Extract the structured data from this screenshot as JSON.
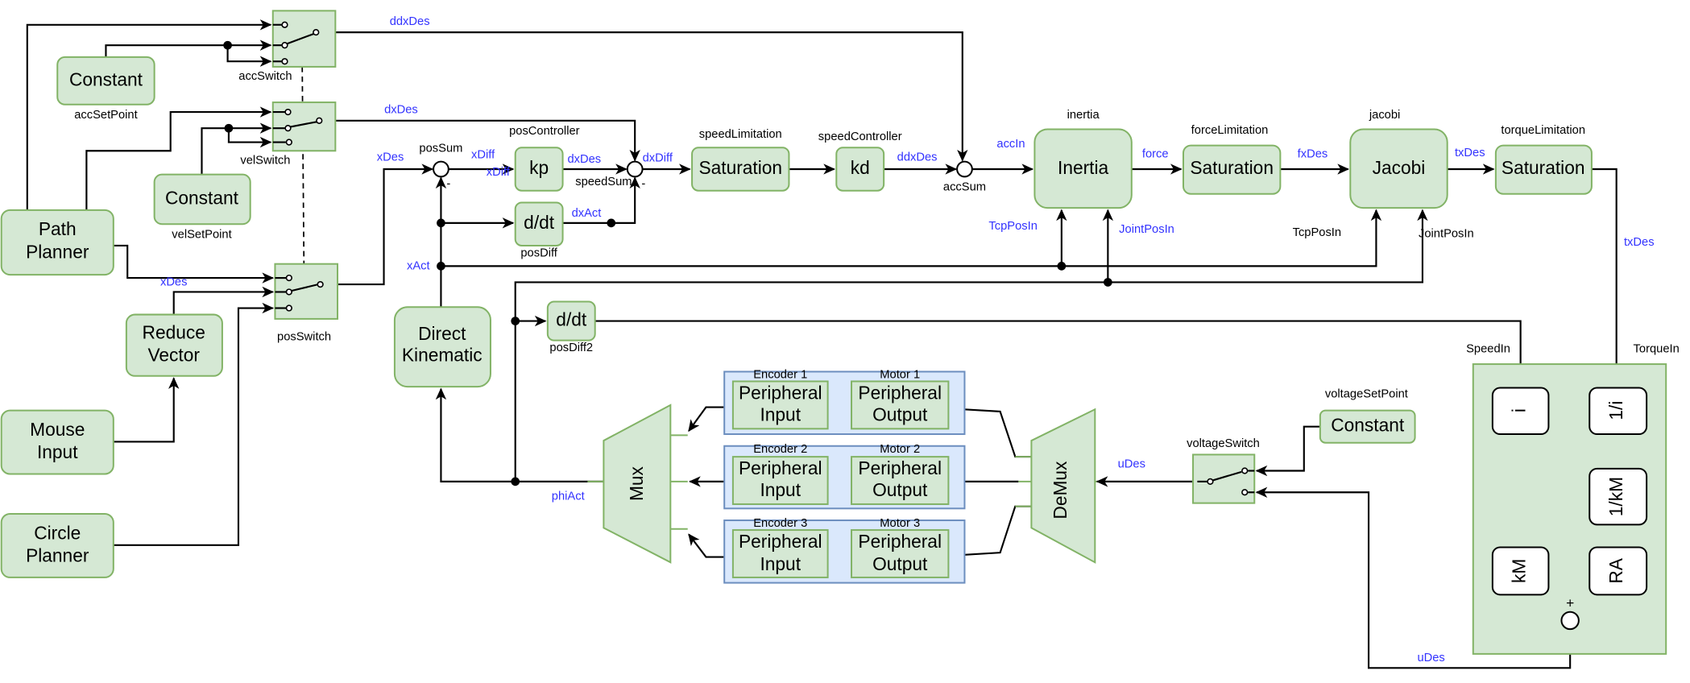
{
  "blocks": {
    "acc_constant": {
      "text": "Constant",
      "label": "accSetPoint"
    },
    "vel_constant": {
      "text": "Constant",
      "label": "velSetPoint"
    },
    "path_planner": {
      "line1": "Path",
      "line2": "Planner"
    },
    "reduce_vector": {
      "line1": "Reduce",
      "line2": "Vector"
    },
    "mouse_input": {
      "line1": "Mouse",
      "line2": "Input"
    },
    "circle_planner": {
      "line1": "Circle",
      "line2": "Planner"
    },
    "acc_switch": {
      "label": "accSwitch"
    },
    "vel_switch": {
      "label": "velSwitch"
    },
    "pos_switch": {
      "label": "posSwitch"
    },
    "pos_sum": {
      "label": "posSum",
      "sign": "-"
    },
    "kp": {
      "text": "kp",
      "label": "posController"
    },
    "pos_diff": {
      "text": "d/dt",
      "label": "posDiff"
    },
    "speed_sum": {
      "label": "speedSum",
      "sign": "-"
    },
    "speed_limitation": {
      "text": "Saturation",
      "label": "speedLimitation"
    },
    "kd": {
      "text": "kd",
      "label": "speedController"
    },
    "acc_sum": {
      "label": "accSum"
    },
    "inertia": {
      "text": "Inertia",
      "label": "inertia"
    },
    "force_limitation": {
      "text": "Saturation",
      "label": "forceLimitation"
    },
    "jacobi": {
      "text": "Jacobi",
      "label": "jacobi",
      "port1": "TcpPosIn",
      "port2": "JointPosIn"
    },
    "torque_limitation": {
      "text": "Saturation",
      "label": "torqueLimitation"
    },
    "direct_kinematic": {
      "line1": "Direct",
      "line2": "Kinematic"
    },
    "pos_diff2": {
      "text": "d/dt",
      "label": "posDiff2"
    },
    "mux": {
      "text": "Mux"
    },
    "demux": {
      "text": "DeMux"
    },
    "voltage_switch": {
      "label": "voltageSwitch"
    },
    "voltage_constant": {
      "text": "Constant",
      "label": "voltageSetPoint"
    },
    "motor": {
      "speed_in": "SpeedIn",
      "torque_in": "TorqueIn",
      "i": "i",
      "inv_i": "1/i",
      "inv_km": "1/kM",
      "km": "kM",
      "ra": "RA",
      "sum_sign": "+"
    }
  },
  "peripherals": [
    {
      "encoder": "Encoder 1",
      "motor": "Motor 1",
      "input_l1": "Peripheral",
      "input_l2": "Input",
      "output_l1": "Peripheral",
      "output_l2": "Output"
    },
    {
      "encoder": "Encoder 2",
      "motor": "Motor 2",
      "input_l1": "Peripheral",
      "input_l2": "Input",
      "output_l1": "Peripheral",
      "output_l2": "Output"
    },
    {
      "encoder": "Encoder 3",
      "motor": "Motor 3",
      "input_l1": "Peripheral",
      "input_l2": "Input",
      "output_l1": "Peripheral",
      "output_l2": "Output"
    }
  ],
  "signals": {
    "ddxDes_top": "ddxDes",
    "dxDes_top": "dxDes",
    "xDes_left": "xDes",
    "xDes_sum": "xDes",
    "xDiff1": "xDiff",
    "xDiff2": "xDiff",
    "dxDes": "dxDes",
    "dxAct": "dxAct",
    "dxDiff": "dxDiff",
    "ddxDes": "ddxDes",
    "accIn": "accIn",
    "force": "force",
    "fxDes": "fxDes",
    "txDes": "txDes",
    "txDes_down": "txDes",
    "TcpPosIn": "TcpPosIn",
    "JointPosIn": "JointPosIn",
    "xAct": "xAct",
    "phiAct": "phiAct",
    "uDes": "uDes",
    "uDes_bottom": "uDes"
  },
  "colors": {
    "block_fill": "#d5e8d4",
    "block_stroke": "#82b366",
    "peripheral_fill": "#dae8fc",
    "peripheral_stroke": "#6c8ebf",
    "signal_label": "#3333ff"
  }
}
